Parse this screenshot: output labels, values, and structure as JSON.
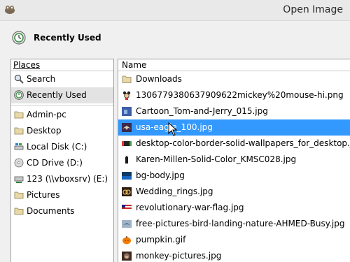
{
  "window": {
    "title": "Open Image"
  },
  "location": {
    "label": "Recently Used",
    "icon": "recent-clock-icon"
  },
  "places": {
    "header": "Places",
    "group1": [
      {
        "label": "Search",
        "icon": "search-icon"
      },
      {
        "label": "Recently Used",
        "icon": "recent-icon",
        "selected": true
      }
    ],
    "group2": [
      {
        "label": "Admin-pc",
        "icon": "folder-icon"
      },
      {
        "label": "Desktop",
        "icon": "folder-icon"
      },
      {
        "label": "Local Disk (C:)",
        "icon": "drive-icon"
      },
      {
        "label": "CD Drive (D:)",
        "icon": "cd-icon"
      },
      {
        "label": "123 (\\\\vboxsrv) (E:)",
        "icon": "network-drive-icon"
      },
      {
        "label": "Pictures",
        "icon": "folder-icon"
      },
      {
        "label": "Documents",
        "icon": "folder-icon"
      }
    ]
  },
  "files": {
    "header": "Name",
    "items": [
      {
        "name": "Downloads",
        "icon": "folder-icon"
      },
      {
        "name": "130677938063790962​2mickey%20mouse-hi.png",
        "icon": "image-thumb-icon"
      },
      {
        "name": "Cartoon_Tom-and-Jerry_015.jpg",
        "icon": "image-thumb-icon"
      },
      {
        "name": "usa-eagle_100.jpg",
        "icon": "image-thumb-icon",
        "selected": true
      },
      {
        "name": "desktop-color-border-solid-wallpapers_for_desktop.jpg",
        "icon": "image-thumb-icon"
      },
      {
        "name": "Karen-Millen-Solid-Color_KMSC028.jpg",
        "icon": "image-thumb-icon"
      },
      {
        "name": "bg-body.jpg",
        "icon": "image-thumb-icon"
      },
      {
        "name": "Wedding_rings.jpg",
        "icon": "image-thumb-icon"
      },
      {
        "name": "revolutionary-war-flag.jpg",
        "icon": "image-thumb-icon"
      },
      {
        "name": "free-pictures-bird-landing-nature-AHMED-Busy.jpg",
        "icon": "image-thumb-icon"
      },
      {
        "name": "pumpkin.gif",
        "icon": "image-thumb-icon"
      },
      {
        "name": "monkey-pictures.jpg",
        "icon": "image-thumb-icon"
      }
    ]
  },
  "colors": {
    "selection": "#3399ff",
    "place_selected": "#e3e3e3"
  }
}
